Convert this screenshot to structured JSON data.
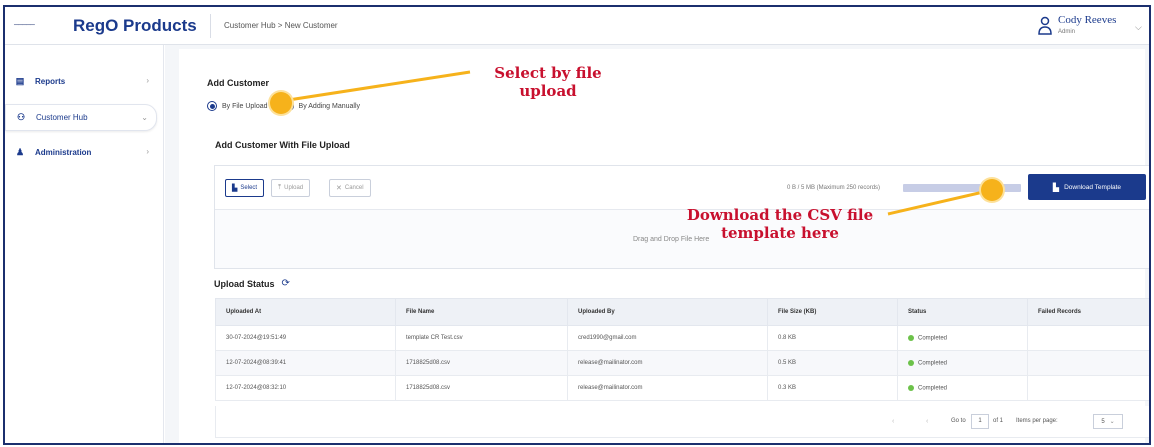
{
  "topbar": {
    "logo_mark": "─────",
    "brand": "RegO Products",
    "breadcrumb": "Customer Hub > New Customer",
    "user_name": "Cody Reeves",
    "user_role": "Admin"
  },
  "sidebar": {
    "items": [
      {
        "label": "Reports",
        "icon": "report-icon"
      },
      {
        "label": "Customer Hub",
        "icon": "customers-icon"
      },
      {
        "label": "Administration",
        "icon": "admin-icon"
      }
    ]
  },
  "main": {
    "add_title": "Add Customer",
    "radio_file": "By File Upload",
    "radio_manual": "By Adding Manually",
    "selected_mode": "By File Upload",
    "upload_title": "Add Customer With File Upload",
    "buttons": {
      "select": "Select",
      "upload": "Upload",
      "cancel": "Cancel"
    },
    "size_info": "0 B / 5 MB (Maximum 250 records)",
    "progress_fraction": 0.0,
    "download_button": "Download Template",
    "drop_text": "Drag and Drop File Here",
    "status_title": "Upload Status"
  },
  "table": {
    "headers": [
      "Uploaded At",
      "File Name",
      "Uploaded By",
      "File Size (KB)",
      "Status",
      "Failed Records"
    ],
    "rows": [
      [
        "30-07-2024@19:51:49",
        "template CR Test.csv",
        "cred1990@gmail.com",
        "0.8 KB",
        "Completed",
        ""
      ],
      [
        "12-07-2024@08:39:41",
        "1718825d08.csv",
        "release@mailinator.com",
        "0.5 KB",
        "Completed",
        ""
      ],
      [
        "12-07-2024@08:32:10",
        "1718825d08.csv",
        "release@mailinator.com",
        "0.3 KB",
        "Completed",
        ""
      ]
    ]
  },
  "pager": {
    "go_to": "Go to",
    "page": "1",
    "of": "of 1",
    "items_per_page": "Items per page:",
    "ipp_value": "5"
  },
  "annotations": {
    "select_line1": "Select by file",
    "select_line2": "upload",
    "download_line1": "Download the CSV file",
    "download_line2": "template here"
  },
  "colors": {
    "brand": "#1b3a8c",
    "callout": "#c8102e",
    "marker": "#f6b21b",
    "status_ok": "#6cc24a"
  }
}
